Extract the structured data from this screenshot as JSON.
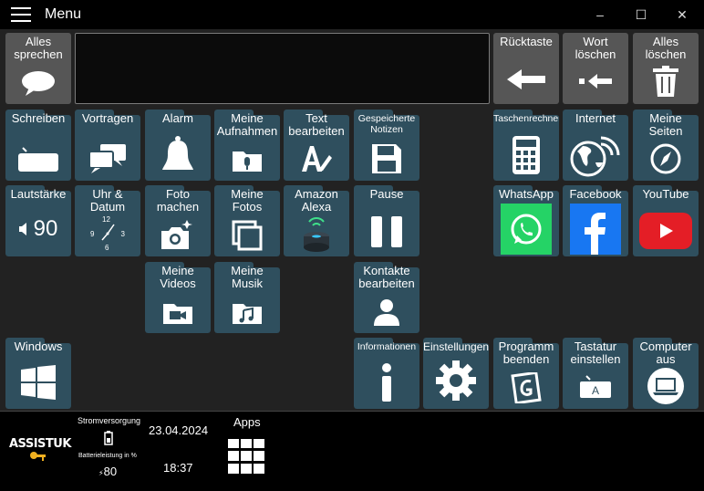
{
  "window": {
    "title": "Menu",
    "minimize": "–",
    "maximize": "☐",
    "close": "✕"
  },
  "top": {
    "speak_all": "Alles\nsprechen",
    "backspace": "Rücktaste",
    "delete_word": "Wort\nlöschen",
    "delete_all": "Alles\nlöschen"
  },
  "tiles": {
    "schreiben": "Schreiben",
    "vortragen": "Vortragen",
    "alarm": "Alarm",
    "aufnahmen": "Meine\nAufnahmen",
    "text_bearbeiten": "Text\nbearbeiten",
    "notizen": "Gespeicherte\nNotizen",
    "taschenrechner": "Taschenrechner",
    "internet": "Internet",
    "seiten": "Meine\nSeiten",
    "lautstaerke": "Lautstärke",
    "lautstaerke_value": "90",
    "uhr": "Uhr &\nDatum",
    "foto": "Foto\nmachen",
    "fotos": "Meine\nFotos",
    "alexa": "Amazon\nAlexa",
    "pause": "Pause",
    "whatsapp": "WhatsApp",
    "facebook": "Facebook",
    "youtube": "YouTube",
    "videos": "Meine\nVideos",
    "musik": "Meine\nMusik",
    "kontakte": "Kontakte\nbearbeiten",
    "windows": "Windows",
    "informationen": "Informationen",
    "einstellungen": "Einstellungen",
    "programm": "Programm\nbeenden",
    "tastatur": "Tastatur\neinstellen",
    "computer": "Computer\naus"
  },
  "clock_face": {
    "n12": "12",
    "n3": "3",
    "n6": "6",
    "n9": "9"
  },
  "status": {
    "logo": "ASSISTUK",
    "power_label": "Stromversorgung",
    "battery_label": "Batterieleistung in %",
    "battery_value": "80",
    "date": "23.04.2024",
    "time": "18:37",
    "apps_label": "Apps"
  },
  "colors": {
    "tile": "#2f4f5e",
    "gray_tile": "#565656",
    "background": "#222222",
    "whatsapp": "#25d366",
    "facebook": "#1877f2",
    "youtube": "#e41e26"
  }
}
